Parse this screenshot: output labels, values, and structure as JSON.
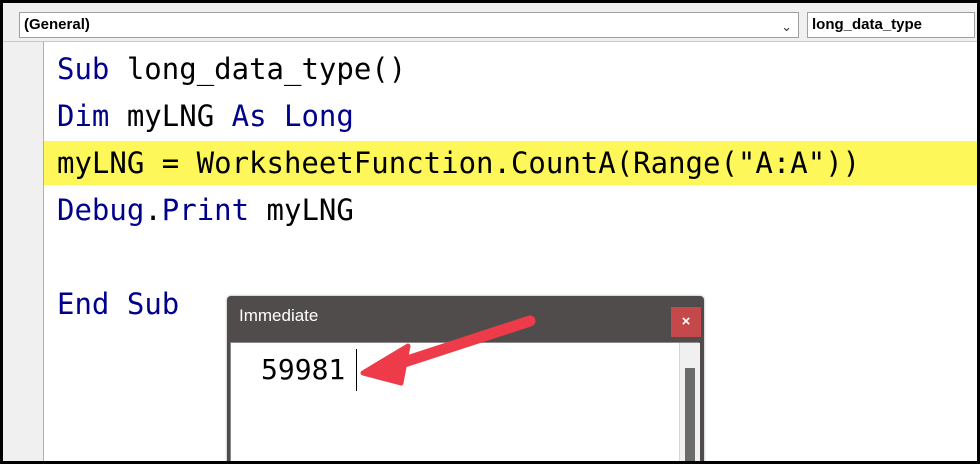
{
  "toolbar": {
    "object_dropdown": "(General)",
    "procedure_dropdown": "long_data_type"
  },
  "code": {
    "line1": {
      "kw1": "Sub",
      "rest": " long_data_type()"
    },
    "line2": {
      "kw1": "Dim",
      "mid1": " myLNG ",
      "kw2": "As",
      "mid2": " ",
      "kw3": "Long"
    },
    "line3": {
      "text": "myLNG = WorksheetFunction.CountA(Range(\"A:A\"))",
      "highlighted": true
    },
    "line4": {
      "kw1": "Debug",
      "mid1": ".",
      "kw2": "Print",
      "rest": " myLNG"
    },
    "line6": {
      "kw1": "End",
      "mid1": " ",
      "kw2": "Sub"
    }
  },
  "immediate": {
    "title": "Immediate",
    "close_label": "×",
    "output": "59981"
  },
  "colors": {
    "keyword": "#00008b",
    "highlight": "#fdf75a",
    "arrow": "#ee3b4a",
    "window_chrome": "#504c4b",
    "close_button": "#c5494b"
  },
  "icons": {
    "dropdown": "chevron-down-icon",
    "annotation": "red-arrow-annotation"
  }
}
